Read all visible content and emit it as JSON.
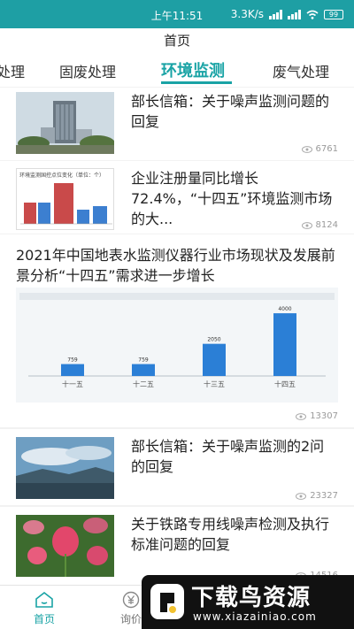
{
  "status_bar": {
    "time": "上午11:51",
    "net_speed": "3.3K/s",
    "battery": "99"
  },
  "header": {
    "title": "首页"
  },
  "tabs": [
    {
      "label": "处理"
    },
    {
      "label": "固废处理"
    },
    {
      "label": "环境监测",
      "active": true
    },
    {
      "label": "废气处理"
    }
  ],
  "feed": [
    {
      "title": "部长信箱：关于噪声监测问题的回复",
      "views": "6761"
    },
    {
      "title": "企业注册量同比增长72.4%，“十四五”环境监测市场的大...",
      "views": "8124",
      "thumb_chart": {
        "title": "环境监测国控点位变化（单位：个）"
      }
    },
    {
      "title": "2021年中国地表水监测仪器行业市场现状及发展前景分析“十四五”需求进一步增长",
      "views": "13307",
      "chart_data": {
        "type": "bar",
        "categories": [
          "十一五",
          "十二五",
          "十三五",
          "十四五"
        ],
        "values": [
          759,
          759,
          2050,
          4000
        ],
        "value_labels": [
          "759",
          "759",
          "2050",
          "4000"
        ],
        "ylim": [
          0,
          4400
        ]
      }
    },
    {
      "title": "部长信箱：关于噪声监测的2问的回复",
      "views": "23327"
    },
    {
      "title": "关于铁路专用线噪声检测及执行标准问题的回复",
      "views": "14516"
    }
  ],
  "bottom_nav": [
    {
      "label": "首页",
      "active": true
    },
    {
      "label": "询价"
    }
  ],
  "watermark": {
    "brand": "下载鸟资源",
    "domain": "www.xiazainiao.com"
  },
  "colors": {
    "accent": "#19a3a5",
    "status_bar": "#1e9fa4",
    "chart_bar": "#2b7fd6"
  }
}
